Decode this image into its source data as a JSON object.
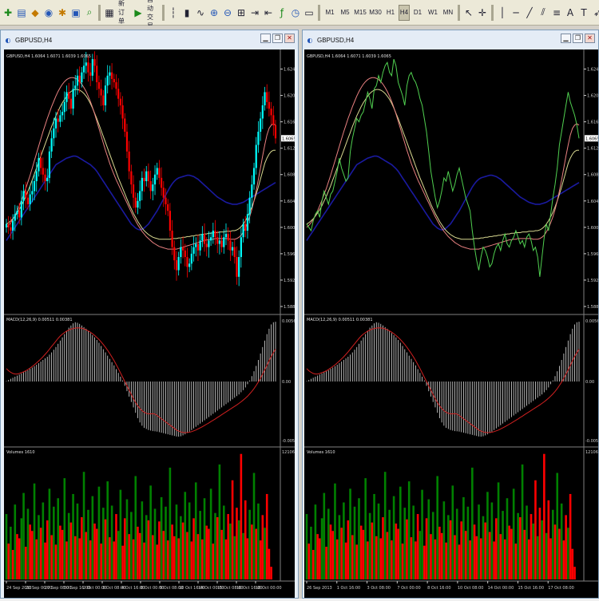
{
  "toolbar": {
    "new_order": "新订单",
    "auto_trading": "自动交易",
    "timeframes": [
      "M1",
      "M5",
      "M15",
      "M30",
      "H1",
      "H4",
      "D1",
      "W1",
      "MN"
    ],
    "active_timeframe": "H4"
  },
  "colors": {
    "bull": "#00ffff",
    "bear": "#ff0000",
    "ma_blue": "#1a1aa0",
    "ma_yellow": "#d8d890",
    "ma_red": "#e88080",
    "line": "#50d050",
    "macd_hist": "#c8c8c8",
    "macd_signal": "#d02020",
    "vol_up": "#008000",
    "vol_down": "#ff0000"
  },
  "windows": [
    {
      "title": "GBPUSD,H4",
      "chart_style": "candles",
      "price_header": "GBPUSD,H4  1.6064 1.6071 1.6039 1.6065",
      "price_ticks": [
        "1.6245",
        "1.6205",
        "1.6165",
        "1.6125",
        "1.6085",
        "1.6045",
        "1.6005",
        "1.5965",
        "1.5925",
        "1.5885"
      ],
      "current_price": "1.6065",
      "macd_header": "MACD(12,26,9) 0.00511 0.00381",
      "macd_ticks": [
        "0.00563",
        "0.00",
        "-0.00548"
      ],
      "volume_header": "Volumes 1610",
      "volume_ticks": [
        "12106"
      ],
      "dates": [
        "24 Sep 2013",
        "26 Sep 00:00",
        "27 Sep 08:00",
        "30 Sep 16:00",
        "2 Oct 00:00",
        "3 Oct 08:00",
        "4 Oct 16:00",
        "8 Oct 00:00",
        "9 Oct 08:00",
        "10 Oct 16:00",
        "14 Oct 00:00",
        "15 Oct 08:00",
        "16 Oct 16:00",
        "18 Oct 00:00"
      ]
    },
    {
      "title": "GBPUSD,H4",
      "chart_style": "line",
      "price_header": "GBPUSD,H4  1.6064 1.6071 1.6039 1.6065",
      "price_ticks": [
        "1.6245",
        "1.6205",
        "1.6165",
        "1.6125",
        "1.6085",
        "1.6045",
        "1.6005",
        "1.5965",
        "1.5925",
        "1.5885"
      ],
      "current_price": "1.6065",
      "macd_header": "MACD(12,26,9) 0.00511 0.00381",
      "macd_ticks": [
        "0.00563",
        "0.00",
        "-0.00548"
      ],
      "volume_header": "Volumes 1610",
      "volume_ticks": [
        "12106"
      ],
      "dates": [
        "26 Sep 2013",
        "1 Oct 16:00",
        "3 Oct 08:00",
        "7 Oct 00:00",
        "8 Oct 16:00",
        "10 Oct 08:00",
        "14 Oct 00:00",
        "15 Oct 16:00",
        "17 Oct 08:00"
      ]
    }
  ],
  "chart_data": {
    "type": "line",
    "title": "GBPUSD,H4",
    "xlabel": "",
    "ylabel": "",
    "ylim": [
      1.5885,
      1.6265
    ],
    "x_tick_labels": [
      "24 Sep 2013",
      "26 Sep 00:00",
      "27 Sep 08:00",
      "30 Sep 16:00",
      "2 Oct 00:00",
      "3 Oct 08:00",
      "4 Oct 16:00",
      "8 Oct 00:00",
      "9 Oct 08:00",
      "10 Oct 16:00",
      "14 Oct 00:00",
      "15 Oct 16:00",
      "16 Oct 16:00",
      "18 Oct 00:00"
    ],
    "close": [
      1.601,
      1.6005,
      1.6,
      1.6015,
      1.6025,
      1.603,
      1.602,
      1.6045,
      1.606,
      1.605,
      1.604,
      1.6055,
      1.606,
      1.6075,
      1.609,
      1.611,
      1.6095,
      1.6085,
      1.6075,
      1.608,
      1.612,
      1.614,
      1.6155,
      1.617,
      1.6165,
      1.6175,
      1.618,
      1.6195,
      1.621,
      1.62,
      1.6185,
      1.6215,
      1.622,
      1.6235,
      1.6225,
      1.624,
      1.625,
      1.6255,
      1.624,
      1.6235,
      1.626,
      1.625,
      1.6225,
      1.6215,
      1.6205,
      1.619,
      1.622,
      1.6235,
      1.624,
      1.623,
      1.6225,
      1.6215,
      1.62,
      1.619,
      1.617,
      1.615,
      1.612,
      1.609,
      1.607,
      1.605,
      1.6035,
      1.6045,
      1.606,
      1.608,
      1.6075,
      1.609,
      1.6075,
      1.606,
      1.607,
      1.6085,
      1.6095,
      1.608,
      1.6065,
      1.605,
      1.604,
      1.603,
      1.6,
      1.5975,
      1.5955,
      1.594,
      1.596,
      1.5975,
      1.597,
      1.596,
      1.5945,
      1.595,
      1.5965,
      1.5975,
      1.598,
      1.597,
      1.5985,
      1.5995,
      1.598,
      1.5975,
      1.5985,
      1.599,
      1.6,
      1.599,
      1.598,
      1.5985,
      1.5975,
      1.599,
      1.5995,
      1.5985,
      1.597,
      1.5975,
      1.596,
      1.593,
      1.596,
      1.599,
      1.601,
      1.6,
      1.6025,
      1.605,
      1.607,
      1.6095,
      1.613,
      1.615,
      1.617,
      1.619,
      1.621,
      1.6195,
      1.6185,
      1.6175,
      1.616,
      1.614
    ],
    "series": [
      {
        "values": [
          1.5985,
          1.599,
          1.5995,
          1.6,
          1.6005,
          1.601,
          1.6015,
          1.602,
          1.6025,
          1.603,
          1.6035,
          1.604,
          1.6045,
          1.605,
          1.6055,
          1.606,
          1.6065,
          1.607,
          1.6075,
          1.608,
          1.6085,
          1.609,
          1.6095,
          1.61,
          1.6102,
          1.6104,
          1.6106,
          1.6108,
          1.611,
          1.6111,
          1.6112,
          1.6113,
          1.6113,
          1.6112,
          1.611,
          1.6108,
          1.6106,
          1.6104,
          1.6102,
          1.61,
          1.6097,
          1.6094,
          1.609,
          1.6085,
          1.608,
          1.6075,
          1.607,
          1.6065,
          1.606,
          1.6055,
          1.605,
          1.6045,
          1.604,
          1.6035,
          1.603,
          1.6025,
          1.602,
          1.6015,
          1.601,
          1.6007,
          1.6004,
          1.6002,
          1.6001,
          1.6002,
          1.6004,
          1.6007,
          1.601,
          1.6015,
          1.602,
          1.6025,
          1.603,
          1.6036,
          1.6042,
          1.6048,
          1.6054,
          1.606,
          1.6066,
          1.6071,
          1.6075,
          1.6078,
          1.608,
          1.6081,
          1.6082,
          1.6083,
          1.6084,
          1.6084,
          1.6083,
          1.6082,
          1.608,
          1.6078,
          1.6075,
          1.6072,
          1.6069,
          1.6066,
          1.6063,
          1.606,
          1.6057,
          1.6054,
          1.6051,
          1.6049,
          1.6047,
          1.6045,
          1.6043,
          1.6042,
          1.6041,
          1.604,
          1.604,
          1.604,
          1.6041,
          1.6042,
          1.6043,
          1.6045,
          1.6047,
          1.6049,
          1.6051,
          1.6053,
          1.6055,
          1.6057,
          1.6059,
          1.6061,
          1.6063,
          1.6065,
          1.6067,
          1.6069,
          1.6071,
          1.6073
        ]
      },
      {
        "values": [
          1.601,
          1.6012,
          1.6015,
          1.6018,
          1.6022,
          1.6027,
          1.6032,
          1.6038,
          1.6045,
          1.6052,
          1.606,
          1.6068,
          1.6077,
          1.6086,
          1.6095,
          1.6104,
          1.6113,
          1.6122,
          1.6131,
          1.614,
          1.6149,
          1.6158,
          1.6166,
          1.6174,
          1.6181,
          1.6188,
          1.6194,
          1.6199,
          1.6204,
          1.6208,
          1.6211,
          1.6213,
          1.6214,
          1.6214,
          1.6213,
          1.6211,
          1.6208,
          1.6204,
          1.6199,
          1.6193,
          1.6186,
          1.6178,
          1.617,
          1.6161,
          1.6152,
          1.6143,
          1.6134,
          1.6125,
          1.6116,
          1.6107,
          1.6098,
          1.6089,
          1.608,
          1.6072,
          1.6064,
          1.6056,
          1.6048,
          1.604,
          1.6033,
          1.6026,
          1.602,
          1.6014,
          1.6009,
          1.6004,
          1.6,
          1.5997,
          1.5994,
          1.5992,
          1.599,
          1.5989,
          1.5988,
          1.5987,
          1.5987,
          1.5987,
          1.5987,
          1.5987,
          1.5987,
          1.5988,
          1.5988,
          1.5988,
          1.5989,
          1.5989,
          1.599,
          1.599,
          1.5991,
          1.5991,
          1.5992,
          1.5992,
          1.5993,
          1.5993,
          1.5994,
          1.5994,
          1.5995,
          1.5995,
          1.5996,
          1.5996,
          1.5997,
          1.5997,
          1.5997,
          1.5998,
          1.5998,
          1.5998,
          1.5999,
          1.5999,
          1.5999,
          1.6,
          1.6,
          1.6001,
          1.6003,
          1.6006,
          1.601,
          1.6015,
          1.6021,
          1.6028,
          1.6036,
          1.6045,
          1.6055,
          1.6066,
          1.6078,
          1.609,
          1.6102,
          1.611,
          1.6116,
          1.612,
          1.6122,
          1.6122
        ]
      },
      {
        "values": [
          1.6005,
          1.6008,
          1.6012,
          1.6017,
          1.6023,
          1.603,
          1.6038,
          1.6046,
          1.6055,
          1.6064,
          1.6074,
          1.6084,
          1.6095,
          1.6106,
          1.6117,
          1.6128,
          1.6139,
          1.615,
          1.616,
          1.617,
          1.6179,
          1.6188,
          1.6196,
          1.6204,
          1.6211,
          1.6217,
          1.6222,
          1.6226,
          1.6229,
          1.6231,
          1.6232,
          1.6232,
          1.6231,
          1.6229,
          1.6226,
          1.6222,
          1.6217,
          1.6211,
          1.6204,
          1.6196,
          1.6187,
          1.6177,
          1.6166,
          1.6155,
          1.6144,
          1.6133,
          1.6122,
          1.6112,
          1.6102,
          1.6093,
          1.6085,
          1.6077,
          1.607,
          1.6063,
          1.6056,
          1.6049,
          1.6042,
          1.6035,
          1.6028,
          1.6021,
          1.6015,
          1.6009,
          1.6004,
          1.5999,
          1.5995,
          1.5991,
          1.5988,
          1.5985,
          1.5982,
          1.598,
          1.5978,
          1.5976,
          1.5975,
          1.5974,
          1.5973,
          1.5972,
          1.5972,
          1.5972,
          1.5972,
          1.5972,
          1.5973,
          1.5974,
          1.5975,
          1.5976,
          1.5977,
          1.5978,
          1.5979,
          1.598,
          1.5981,
          1.5982,
          1.5983,
          1.5984,
          1.5985,
          1.5986,
          1.5986,
          1.5987,
          1.5987,
          1.5988,
          1.5988,
          1.5988,
          1.5988,
          1.5988,
          1.5988,
          1.5988,
          1.5987,
          1.5987,
          1.5987,
          1.5988,
          1.599,
          1.5993,
          1.5998,
          1.6004,
          1.6012,
          1.6021,
          1.6032,
          1.6045,
          1.606,
          1.6077,
          1.6095,
          1.6113,
          1.613,
          1.6145,
          1.6155,
          1.616,
          1.6162,
          1.616
        ]
      }
    ],
    "macd_ylim": [
      -0.00548,
      0.00563
    ],
    "macd_hist": [
      5e-05,
      0.00015,
      0.00025,
      0.00035,
      0.00045,
      0.00055,
      0.00065,
      0.00075,
      0.00085,
      0.00095,
      0.00105,
      0.00118,
      0.0013,
      0.00143,
      0.00156,
      0.0017,
      0.00185,
      0.002,
      0.00215,
      0.0023,
      0.0025,
      0.0027,
      0.00295,
      0.0032,
      0.0035,
      0.0038,
      0.0041,
      0.0044,
      0.0047,
      0.005,
      0.0052,
      0.0054,
      0.0055,
      0.00545,
      0.00535,
      0.0052,
      0.00505,
      0.0049,
      0.0047,
      0.0045,
      0.0043,
      0.0041,
      0.00385,
      0.0036,
      0.0033,
      0.003,
      0.0027,
      0.0024,
      0.0021,
      0.0018,
      0.0015,
      0.00115,
      0.0008,
      0.00045,
      0.0001,
      -0.0004,
      -0.0009,
      -0.0014,
      -0.0019,
      -0.0024,
      -0.0029,
      -0.0034,
      -0.0038,
      -0.0041,
      -0.0043,
      -0.0044,
      -0.0045,
      -0.00455,
      -0.0046,
      -0.00462,
      -0.00465,
      -0.0047,
      -0.00475,
      -0.0048,
      -0.00485,
      -0.0049,
      -0.00495,
      -0.005,
      -0.00505,
      -0.0051,
      -0.00512,
      -0.00508,
      -0.005,
      -0.0049,
      -0.00478,
      -0.00465,
      -0.0045,
      -0.00435,
      -0.0042,
      -0.00405,
      -0.0039,
      -0.00375,
      -0.0036,
      -0.00345,
      -0.0033,
      -0.00315,
      -0.003,
      -0.00285,
      -0.0027,
      -0.00255,
      -0.0024,
      -0.00225,
      -0.0021,
      -0.00195,
      -0.0018,
      -0.00165,
      -0.0015,
      -0.00135,
      -0.0012,
      -0.001,
      -0.0008,
      -0.00055,
      -0.00025,
      0.0001,
      0.0005,
      0.00095,
      0.00145,
      0.002,
      0.0026,
      0.0032,
      0.0038,
      0.0044,
      0.0049,
      0.0053,
      0.0055,
      0.00555
    ],
    "macd_signal": [
      0.0012,
      0.001,
      0.00085,
      0.00075,
      0.0007,
      0.0007,
      0.00075,
      0.00082,
      0.0009,
      0.001,
      0.00112,
      0.00125,
      0.0014,
      0.00155,
      0.00172,
      0.0019,
      0.0021,
      0.0023,
      0.00252,
      0.00275,
      0.003,
      0.00325,
      0.0035,
      0.00375,
      0.004,
      0.00422,
      0.0044,
      0.00455,
      0.00468,
      0.00478,
      0.00486,
      0.00492,
      0.00496,
      0.00498,
      0.00497,
      0.00494,
      0.00488,
      0.0048,
      0.0047,
      0.00458,
      0.00444,
      0.00428,
      0.0041,
      0.0039,
      0.00368,
      0.00344,
      0.00318,
      0.0029,
      0.0026,
      0.00228,
      0.00194,
      0.00158,
      0.0012,
      0.0008,
      0.0004,
      0.0,
      -0.0004,
      -0.0008,
      -0.0012,
      -0.0016,
      -0.00195,
      -0.00225,
      -0.0025,
      -0.0027,
      -0.00285,
      -0.00295,
      -0.003,
      -0.003,
      -0.00298,
      -0.00302,
      -0.00315,
      -0.0033,
      -0.00345,
      -0.0036,
      -0.00375,
      -0.0039,
      -0.00405,
      -0.0042,
      -0.00435,
      -0.0045,
      -0.0046,
      -0.00468,
      -0.00472,
      -0.00474,
      -0.00473,
      -0.0047,
      -0.00465,
      -0.00458,
      -0.0045,
      -0.0044,
      -0.0043,
      -0.0042,
      -0.00408,
      -0.00396,
      -0.00384,
      -0.00372,
      -0.0036,
      -0.00347,
      -0.00334,
      -0.00321,
      -0.00308,
      -0.00295,
      -0.00282,
      -0.00269,
      -0.00256,
      -0.00243,
      -0.0023,
      -0.00217,
      -0.00203,
      -0.00188,
      -0.00172,
      -0.00155,
      -0.00136,
      -0.00115,
      -0.00092,
      -0.00066,
      -0.00037,
      -5e-05,
      0.0003,
      0.00068,
      0.00108,
      0.0015,
      0.00192,
      0.00232,
      0.00268,
      0.003
    ],
    "volume_ylim": [
      0,
      12106
    ],
    "volume": [
      6200,
      3400,
      5000,
      2800,
      7100,
      4300,
      3900,
      5800,
      8200,
      3100,
      6700,
      5200,
      4600,
      9100,
      3800,
      6100,
      4900,
      7300,
      3500,
      5600,
      8600,
      4200,
      6900,
      3300,
      7700,
      5100,
      4700,
      9600,
      3600,
      6300,
      5400,
      8100,
      4100,
      7200,
      3900,
      5900,
      10200,
      4500,
      6600,
      3700,
      7900,
      5300,
      4800,
      8800,
      3400,
      6800,
      5700,
      9300,
      4000,
      7000,
      3600,
      6200,
      4600,
      8500,
      3200,
      5800,
      7600,
      4300,
      6400,
      3800,
      9800,
      5000,
      4400,
      7400,
      3500,
      6100,
      5600,
      8900,
      4200,
      6700,
      3300,
      5500,
      7800,
      4600,
      6900,
      3700,
      10600,
      5200,
      4100,
      7100,
      3900,
      6000,
      5400,
      8300,
      4500,
      7300,
      3600,
      5800,
      9200,
      4300,
      6500,
      3800,
      7700,
      5100,
      4800,
      8600,
      3400,
      6300,
      5900,
      10900,
      4700,
      7000,
      3800,
      6200,
      5300,
      9400,
      4100,
      6800,
      5600,
      11900,
      4400,
      7500,
      3900,
      6600,
      5200,
      10100,
      4800,
      7200,
      3700,
      6100,
      4900,
      8100,
      2900,
      1200
    ],
    "volume_up": [
      true,
      false,
      true,
      false,
      true,
      false,
      false,
      true,
      true,
      false,
      true,
      false,
      false,
      true,
      false,
      true,
      false,
      true,
      false,
      false,
      true,
      false,
      true,
      false,
      true,
      false,
      false,
      true,
      false,
      true,
      false,
      true,
      false,
      true,
      false,
      false,
      true,
      false,
      true,
      false,
      true,
      false,
      false,
      true,
      false,
      true,
      false,
      true,
      false,
      true,
      false,
      false,
      true,
      true,
      false,
      false,
      true,
      false,
      true,
      false,
      true,
      false,
      false,
      true,
      false,
      true,
      false,
      true,
      false,
      true,
      false,
      false,
      true,
      false,
      true,
      false,
      true,
      false,
      false,
      true,
      false,
      true,
      false,
      true,
      false,
      true,
      false,
      false,
      true,
      false,
      true,
      false,
      true,
      false,
      false,
      true,
      false,
      true,
      false,
      true,
      false,
      true,
      false,
      false,
      true,
      false,
      true,
      false,
      true,
      false,
      true,
      false,
      false,
      true,
      false,
      true,
      false,
      true,
      false,
      false,
      true,
      false,
      false,
      false
    ]
  }
}
